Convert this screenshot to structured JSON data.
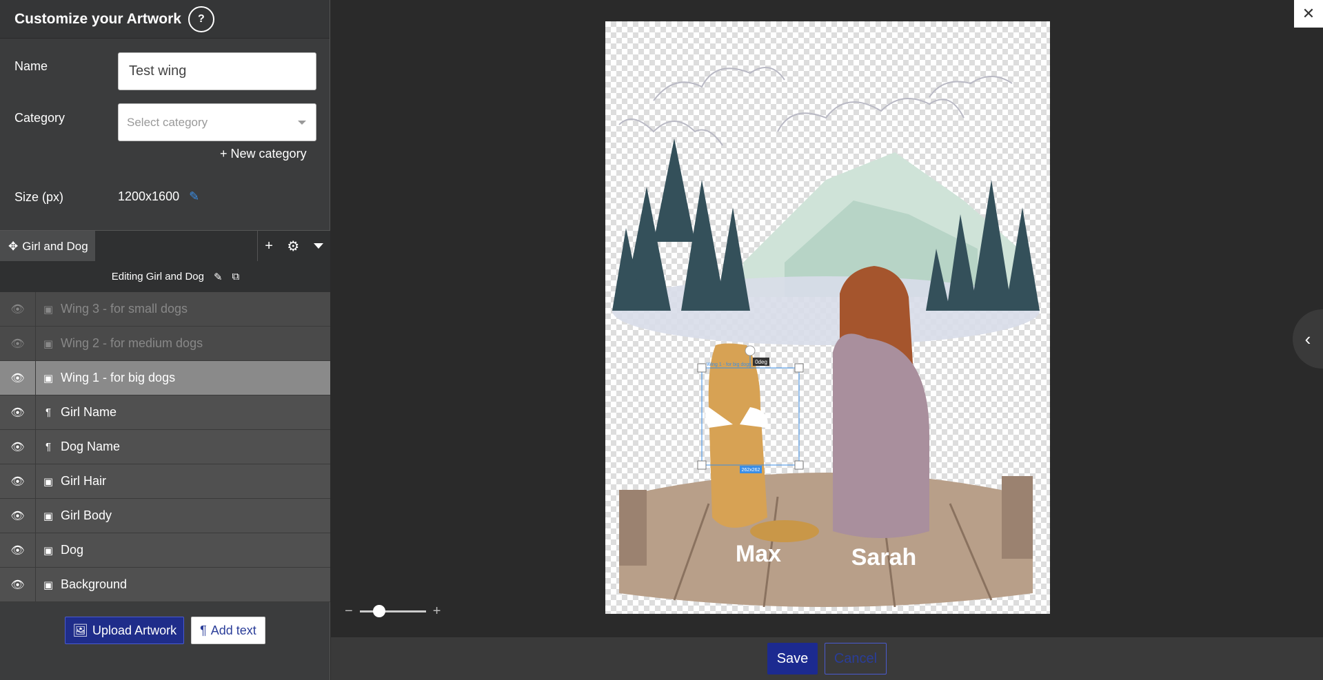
{
  "sidebar": {
    "title": "Customize your Artwork",
    "help_icon": "question-mark-icon",
    "name_label": "Name",
    "name_value": "Test wing",
    "category_label": "Category",
    "category_placeholder": "Select category",
    "new_category": "New category",
    "size_label": "Size (px)",
    "size_value": "1200x1600"
  },
  "tabs": {
    "active_tab": "Girl and Dog",
    "editing_label": "Editing Girl and Dog"
  },
  "layers": [
    {
      "label": "Wing 3 - for small dogs",
      "type": "image",
      "state": "hidden"
    },
    {
      "label": "Wing 2 - for medium dogs",
      "type": "image",
      "state": "hidden"
    },
    {
      "label": "Wing 1 - for big dogs",
      "type": "image",
      "state": "selected"
    },
    {
      "label": "Girl Name",
      "type": "text",
      "state": "visible"
    },
    {
      "label": "Dog Name",
      "type": "text",
      "state": "visible"
    },
    {
      "label": "Girl Hair",
      "type": "image",
      "state": "visible"
    },
    {
      "label": "Girl Body",
      "type": "image",
      "state": "visible"
    },
    {
      "label": "Dog",
      "type": "image",
      "state": "visible"
    },
    {
      "label": "Background",
      "type": "image",
      "state": "visible"
    }
  ],
  "buttons": {
    "upload": "Upload Artwork",
    "add_text": "Add text",
    "save": "Save",
    "cancel": "Cancel"
  },
  "canvas": {
    "dog_name": "Max",
    "girl_name": "Sarah",
    "rotation_badge": "0deg",
    "size_badge": "262x262",
    "selection_label": "Wing 1 - for big dogs"
  },
  "zoom": {
    "minus": "−",
    "plus": "+",
    "level": 0.3
  },
  "colors": {
    "accent": "#1c2a90",
    "selection": "#3a8ee6"
  }
}
